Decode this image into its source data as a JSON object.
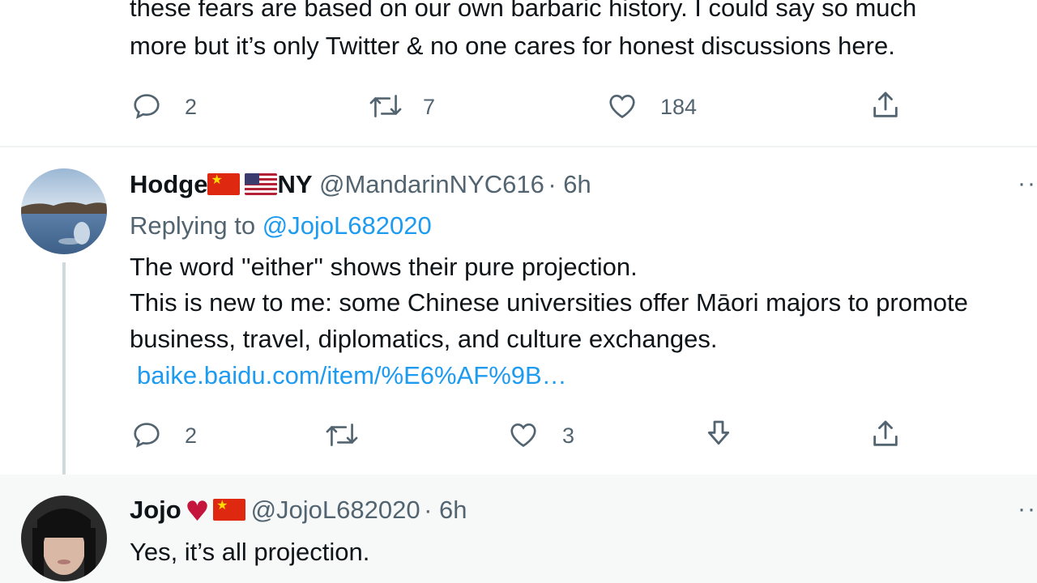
{
  "tweet_prev": {
    "line1": "these fears are based on our own barbaric history. I could say so much",
    "line2": "more but it’s only Twitter & no one cares for honest discussions here.",
    "replies": "2",
    "retweets": "7",
    "likes": "184"
  },
  "tweet_hodge": {
    "name": "Hodge",
    "name_suffix": "NY",
    "handle": "@MandarinNYC616",
    "time": "· 6h",
    "replying_prefix": "Replying to",
    "replying_handle": "@JojoL682020",
    "line1": "The word ''either'' shows their pure projection.",
    "line2": "This is new to me: some Chinese universities offer Māori majors to promote",
    "line3": "business, travel, diplomatics, and culture exchanges.",
    "link": "baike.baidu.com/item/%E6%AF%9B…",
    "replies": "2",
    "retweets": "",
    "likes": "3",
    "more": "··"
  },
  "tweet_jojo": {
    "name": "Jojo",
    "handle": "@JojoL682020",
    "time": "· 6h",
    "line1": "Yes, it’s all projection.",
    "more": "··"
  },
  "colors": {
    "text": "#0f1419",
    "secondary": "#536471",
    "link": "#1d9bf0",
    "divider": "#eff3f4",
    "thread_line": "#cfd9de",
    "highlight_bg": "#f7f9f9"
  },
  "icons": [
    "reply-icon",
    "retweet-icon",
    "like-icon",
    "share-icon",
    "download-icon",
    "more-icon"
  ]
}
